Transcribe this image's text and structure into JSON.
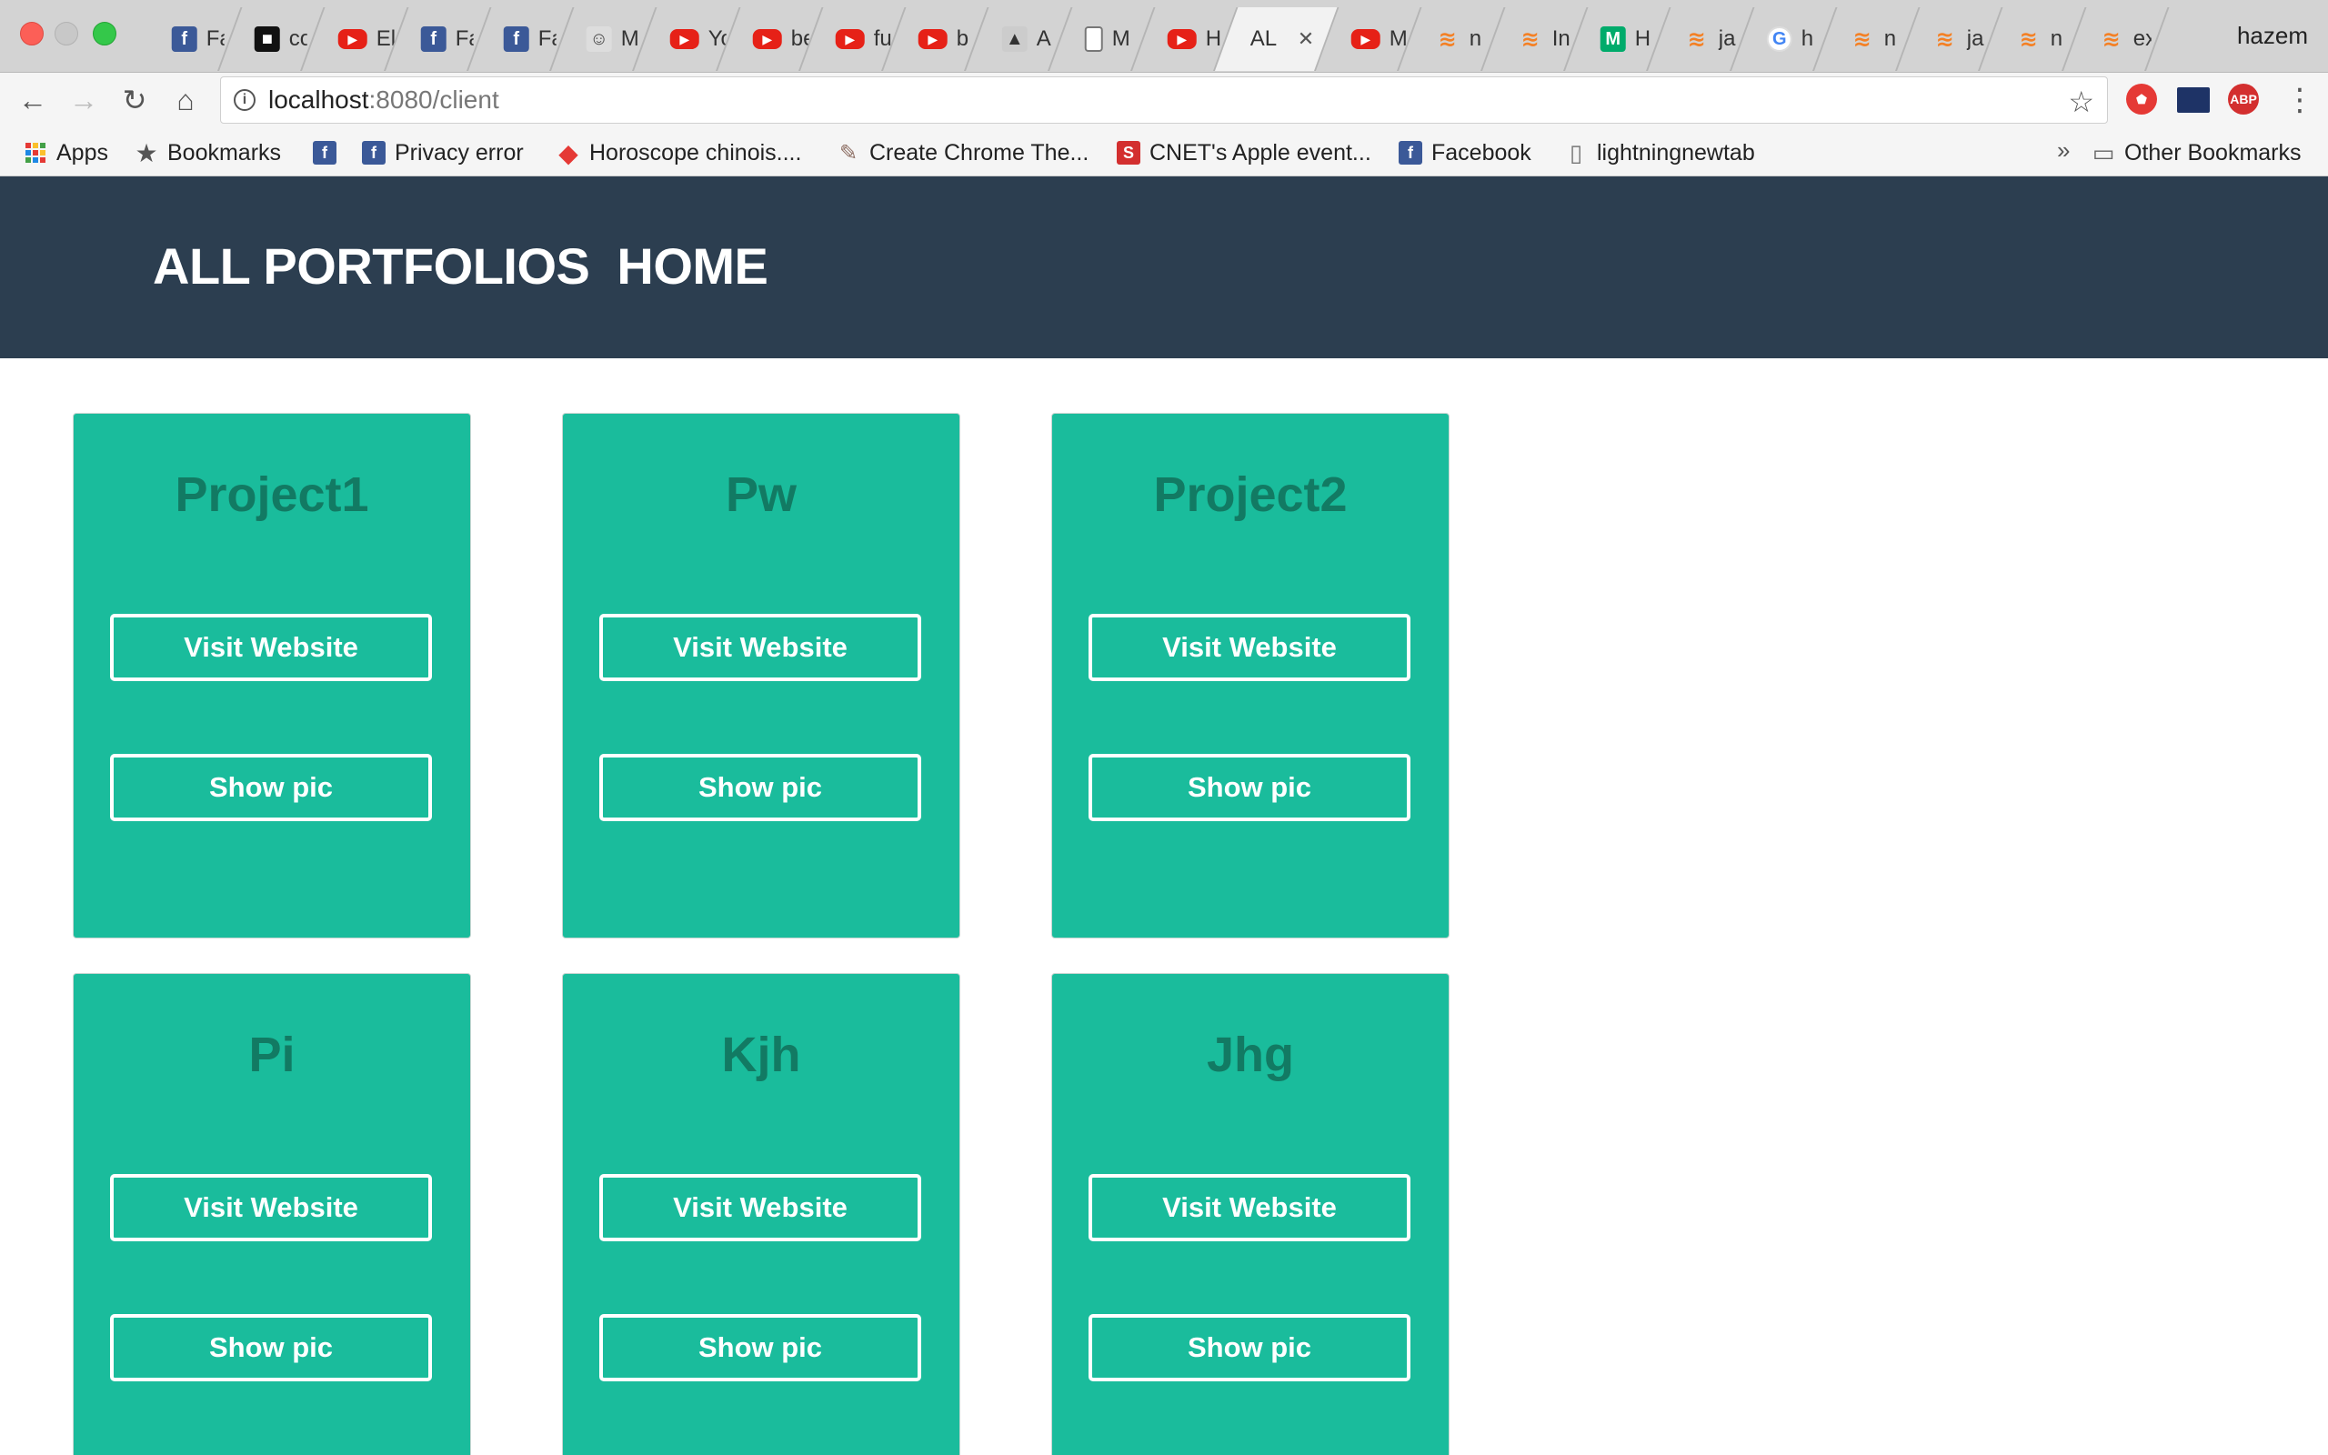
{
  "browser": {
    "tabs": [
      {
        "icon": "facebook-icon",
        "label": "Fa",
        "kind": "fb"
      },
      {
        "icon": "dark-site-icon",
        "label": "co",
        "kind": "dark"
      },
      {
        "icon": "youtube-icon",
        "label": "El",
        "kind": "yt"
      },
      {
        "icon": "facebook-icon",
        "label": "Fa",
        "kind": "fb"
      },
      {
        "icon": "facebook-icon",
        "label": "Fa",
        "kind": "fb"
      },
      {
        "icon": "face-icon",
        "label": "M",
        "kind": "face"
      },
      {
        "icon": "youtube-icon",
        "label": "Yo",
        "kind": "yt"
      },
      {
        "icon": "youtube-icon",
        "label": "be",
        "kind": "yt"
      },
      {
        "icon": "youtube-icon",
        "label": "fu",
        "kind": "yt"
      },
      {
        "icon": "youtube-icon",
        "label": "b",
        "kind": "yt"
      },
      {
        "icon": "cap-icon",
        "label": "A",
        "kind": "cap"
      },
      {
        "icon": "document-icon",
        "label": "M",
        "kind": "doc"
      },
      {
        "icon": "youtube-icon",
        "label": "H",
        "kind": "yt"
      },
      {
        "icon": "none",
        "label": "AL",
        "kind": "active"
      },
      {
        "icon": "youtube-icon",
        "label": "M",
        "kind": "yt"
      },
      {
        "icon": "stackoverflow-icon",
        "label": "n",
        "kind": "so"
      },
      {
        "icon": "stackoverflow-icon",
        "label": "In",
        "kind": "so"
      },
      {
        "icon": "medium-icon",
        "label": "H",
        "kind": "med"
      },
      {
        "icon": "stackoverflow-icon",
        "label": "ja",
        "kind": "so"
      },
      {
        "icon": "google-icon",
        "label": "h",
        "kind": "g"
      },
      {
        "icon": "stackoverflow-icon",
        "label": "n",
        "kind": "so"
      },
      {
        "icon": "stackoverflow-icon",
        "label": "ja",
        "kind": "so"
      },
      {
        "icon": "stackoverflow-icon",
        "label": "n",
        "kind": "so"
      },
      {
        "icon": "stackoverflow-icon",
        "label": "ex",
        "kind": "so"
      }
    ],
    "profile_name": "hazem",
    "address": {
      "host": "localhost",
      "path": ":8080/client"
    },
    "bookmarks": [
      {
        "label": "Apps",
        "icon": "apps-grid-icon"
      },
      {
        "label": "Bookmarks",
        "icon": "star-icon"
      },
      {
        "label": "",
        "icon": "facebook-icon"
      },
      {
        "label": "Privacy error",
        "icon": "facebook-icon"
      },
      {
        "label": "Horoscope chinois....",
        "icon": "diamond-icon"
      },
      {
        "label": "Create Chrome The...",
        "icon": "paint-icon"
      },
      {
        "label": "CNET's Apple event...",
        "icon": "cnet-icon"
      },
      {
        "label": "Facebook",
        "icon": "facebook-icon"
      },
      {
        "label": "lightningnewtab",
        "icon": "file-icon"
      }
    ],
    "bookmarks_overflow": "»",
    "other_bookmarks": "Other Bookmarks"
  },
  "site": {
    "title_part1": "ALL PORTFOLIOS",
    "title_part2": "HOME",
    "header_color": "#2c3e50",
    "card_color": "#1abc9c",
    "projects": [
      {
        "name": "Project1",
        "visit_label": "Visit Website",
        "pic_label": "Show pic"
      },
      {
        "name": "Pw",
        "visit_label": "Visit Website",
        "pic_label": "Show pic"
      },
      {
        "name": "Project2",
        "visit_label": "Visit Website",
        "pic_label": "Show pic"
      },
      {
        "name": "Pi",
        "visit_label": "Visit Website",
        "pic_label": "Show pic"
      },
      {
        "name": "Kjh",
        "visit_label": "Visit Website",
        "pic_label": "Show pic"
      },
      {
        "name": "Jhg",
        "visit_label": "Visit Website",
        "pic_label": "Show pic"
      }
    ]
  }
}
